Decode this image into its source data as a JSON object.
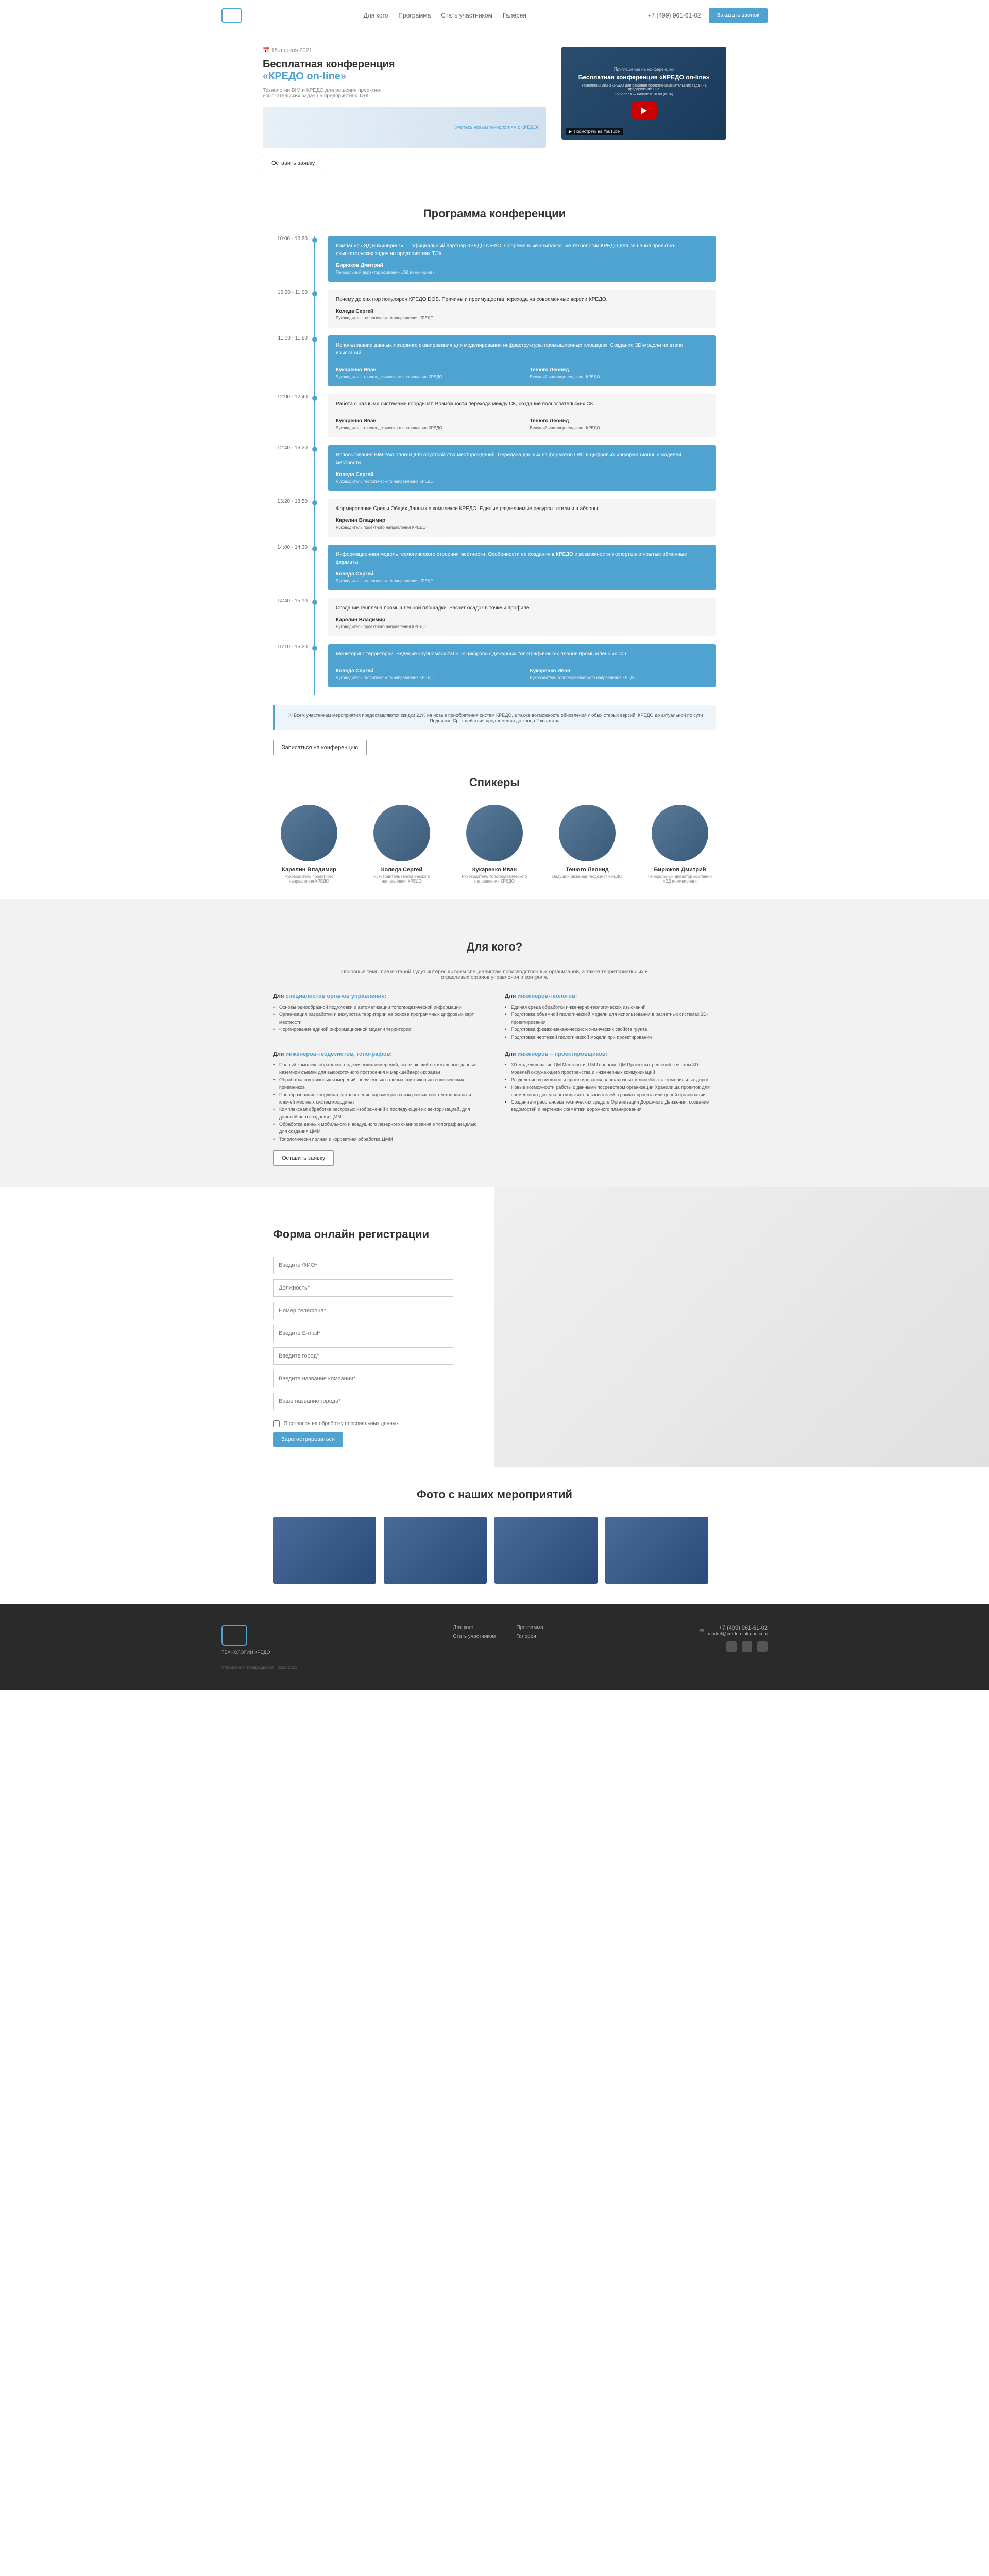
{
  "header": {
    "nav": [
      "Для кого",
      "Программа",
      "Стать участником",
      "Галерея"
    ],
    "phone": "+7 (499) 961-61-02",
    "cta": "Заказать звонок"
  },
  "hero": {
    "date": "15 апреля 2021",
    "title1": "Бесплатная конференция",
    "title2": "«КРЕДО on-line»",
    "subtitle": "Технологии BIM и КРЕДО для решения проектно-изыскательских задач на предприятиях ТЭК",
    "banner_text": "Учитесь новым технологиям с КРЕДО!",
    "btn": "Оставить заявку",
    "video_pretitle": "Приглашение на конференцию",
    "video_title": "Бесплатная конференция «КРЕДО on-line»",
    "video_sub1": "Технологии BIM и КРЕДО для решения проектно-изыскательских задач на предприятиях ТЭК",
    "video_sub2": "15 апреля — начало в 10.00 (МСК)",
    "yt_badge": "Посмотреть на YouTube"
  },
  "program": {
    "title": "Программа конференции",
    "items": [
      {
        "time": "10:00 - 10:20",
        "topic": "Компания «ЭД инжиниринг» — официальный партнер КРЕДО в НАО. Современные комплексные технологии КРЕДО для решения проектно-изыскательских задач на предприятиях ТЭК.",
        "speakers": [
          {
            "name": "Бирюков Дмитрий",
            "role": "Генеральный директор компании «ЭД инжиниринг»"
          }
        ],
        "blue": true
      },
      {
        "time": "10:20 - 11:00",
        "topic": "Почему до сих пор популярен КРЕДО DOS. Причины и преимущества перехода на современные версии КРЕДО.",
        "speakers": [
          {
            "name": "Коледа Сергей",
            "role": "Руководитель геологического направления КРЕДО"
          }
        ],
        "blue": false
      },
      {
        "time": "11:10 - 11:50",
        "topic": "Использование данных лазерного сканирования для моделирования инфраструктуры промышленных площадок. Создание 3D-модели на этапе изысканий.",
        "speakers": [
          {
            "name": "Кукаренко Иван",
            "role": "Руководитель топогеодезического направления КРЕДО"
          },
          {
            "name": "Тенюго Леонид",
            "role": "Ведущий инженер-геодезист КРЕДО"
          }
        ],
        "blue": true
      },
      {
        "time": "12:00 - 12:40",
        "topic": "Работа с разными системами координат. Возможности перехода между СК, создание пользовательских СК.",
        "speakers": [
          {
            "name": "Кукаренко Иван",
            "role": "Руководитель топогеодезического направления КРЕДО"
          },
          {
            "name": "Тенюго Леонид",
            "role": "Ведущий инженер-геодезист КРЕДО"
          }
        ],
        "blue": false
      },
      {
        "time": "12:40 - 13:20",
        "topic": "Использование BIM-технологий для обустройства месторождений. Передача данных из форматов ГИС и цифровых информационных моделей местности.",
        "speakers": [
          {
            "name": "Коледа Сергей",
            "role": "Руководитель геологического направления КРЕДО"
          }
        ],
        "blue": true
      },
      {
        "time": "13:20 - 13:50",
        "topic": "Формирование Среды Общих Данных в комплексе КРЕДО. Единые разделяемые ресурсы: стили и шаблоны.",
        "speakers": [
          {
            "name": "Карелин Владимир",
            "role": "Руководитель проектного направления КРЕДО"
          }
        ],
        "blue": false
      },
      {
        "time": "14:00 - 14:30",
        "topic": "Информационная модель геологического строения местности. Особенности ее создания в КРЕДО и возможности экспорта в открытые обменные форматы.",
        "speakers": [
          {
            "name": "Коледа Сергей",
            "role": "Руководитель геологического направления КРЕДО"
          }
        ],
        "blue": true
      },
      {
        "time": "14:40 - 15:10",
        "topic": "Создание генплана промышленной площадки. Расчет осадок в точке и профиле.",
        "speakers": [
          {
            "name": "Карелин Владимир",
            "role": "Руководитель проектного направления КРЕДО"
          }
        ],
        "blue": false
      },
      {
        "time": "15:10 - 15:20",
        "topic": "Мониторинг территорий. Ведение крупномасштабных цифровых дежурных топографических планов промышленных зон.",
        "speakers": [
          {
            "name": "Коледа Сергей",
            "role": "Руководитель геологического направления КРЕДО"
          },
          {
            "name": "Кукаренко Иван",
            "role": "Руководитель топогеодезического направления КРЕДО"
          }
        ],
        "blue": true
      }
    ],
    "info": "Всем участникам мероприятия предоставляются скидки 21% на новые приобретения систем КРЕДО, а также возможность обновления любых старых версий. КРЕДО до актуальной по сути Подписки. Срок действия предложения до конца 2 квартала.",
    "signup_btn": "Записаться на конференцию"
  },
  "speakers": {
    "title": "Спикеры",
    "list": [
      {
        "name": "Карелин Владимир",
        "role": "Руководитель проектного направления КРЕДО"
      },
      {
        "name": "Коледа Сергей",
        "role": "Руководитель геологического направления КРЕДО"
      },
      {
        "name": "Кукаренко Иван",
        "role": "Руководитель топогеодезического направления КРЕДО"
      },
      {
        "name": "Тенюго Леонид",
        "role": "Ведущий инженер-геодезист КРЕДО"
      },
      {
        "name": "Бирюков Дмитрий",
        "role": "Генеральный директор компании «ЭД инжиниринг»"
      }
    ]
  },
  "audience": {
    "title": "Для кого?",
    "intro": "Основные темы презентаций будут интересны всем специалистам производственных организаций, а также территориальных и отраслевых органов управления и контроля.",
    "blocks": [
      {
        "heading_prefix": "Для ",
        "heading": "специалистов органов управления:",
        "items": [
          "Основы однообразной подготовки и автоматизации топогеодезической информации",
          "Организация разработки и дежурства территории на основе программных цифровых карт местности",
          "Формирование единой информационной модели территории"
        ]
      },
      {
        "heading_prefix": "Для ",
        "heading": "инженеров-геологов:",
        "items": [
          "Единая среда обработки инженерно-геологических изысканий",
          "Подготовка объемной геологической модели для использования в расчетных системах 3D-проектирования",
          "Подготовка физико-механических и химических свойств грунта",
          "Подготовка чертежей геологической модели при проектировании"
        ]
      },
      {
        "heading_prefix": "Для ",
        "heading": "инженеров-геодезистов, топографов:",
        "items": [
          "Полный комплекс обработки геодезических измерений, включающий оптимальные данные наземной съемки для высокоточного построения и маркшейдерских задач",
          "Обработка спутниковых измерений, полученных с любых спутниковых геодезических приемников",
          "Преобразование координат, установление параметров связи разных систем координат и ключей местных систем координат",
          "Комплексная обработка растровых изображений с последующей их векторизацией, для дальнейшего создания ЦММ",
          "Обработка данных мобильного и воздушного лазерного сканирования в топографии целью для создания ЦММ",
          "Топологически полная и корректная обработка ЦММ"
        ]
      },
      {
        "heading_prefix": "Для ",
        "heading": "инженеров – проектировщиков:",
        "items": [
          "3D-моделирование ЦМ Местности, ЦМ Геологии, ЦМ Проектных решений с учетом 3D-моделей окружающего пространства и инженерных коммуникаций",
          "Разделение возможности проектирования площадочных и линейных автомобильных дорог",
          "Новые возможности работы с данными посредством организации Хранилища проектов для совместного доступа нескольких пользователей в рамках проекта или целой организации",
          "Создание и расстановка технических средств Организации Дорожного Движения, создание ведомостей и чертежей схематики дорожного планирования"
        ]
      }
    ],
    "btn": "Оставить заявку"
  },
  "form": {
    "title": "Форма онлайн регистрации",
    "fields": {
      "fio": "Введите ФИО*",
      "position": "Должность*",
      "phone": "Номер телефона*",
      "email": "Введите E-mail*",
      "city": "Введите город*",
      "company": "Введите название компании*",
      "city2": "Ваше название города*"
    },
    "consent": "Я согласен на обработку персональных данных",
    "submit": "Зарегистрироваться"
  },
  "gallery": {
    "title": "Фото с наших мероприятий"
  },
  "footer": {
    "brand": "ТЕХНОЛОГИИ КРЕДО",
    "nav1": [
      "Для кого",
      "Стать участником"
    ],
    "nav2": [
      "Программа",
      "Галерея"
    ],
    "phone": "+7 (499) 961-61-02",
    "email": "market@credo-dialogue.com",
    "copyright": "© Компания \"Кредо-Диалог\", 2012-2021"
  }
}
